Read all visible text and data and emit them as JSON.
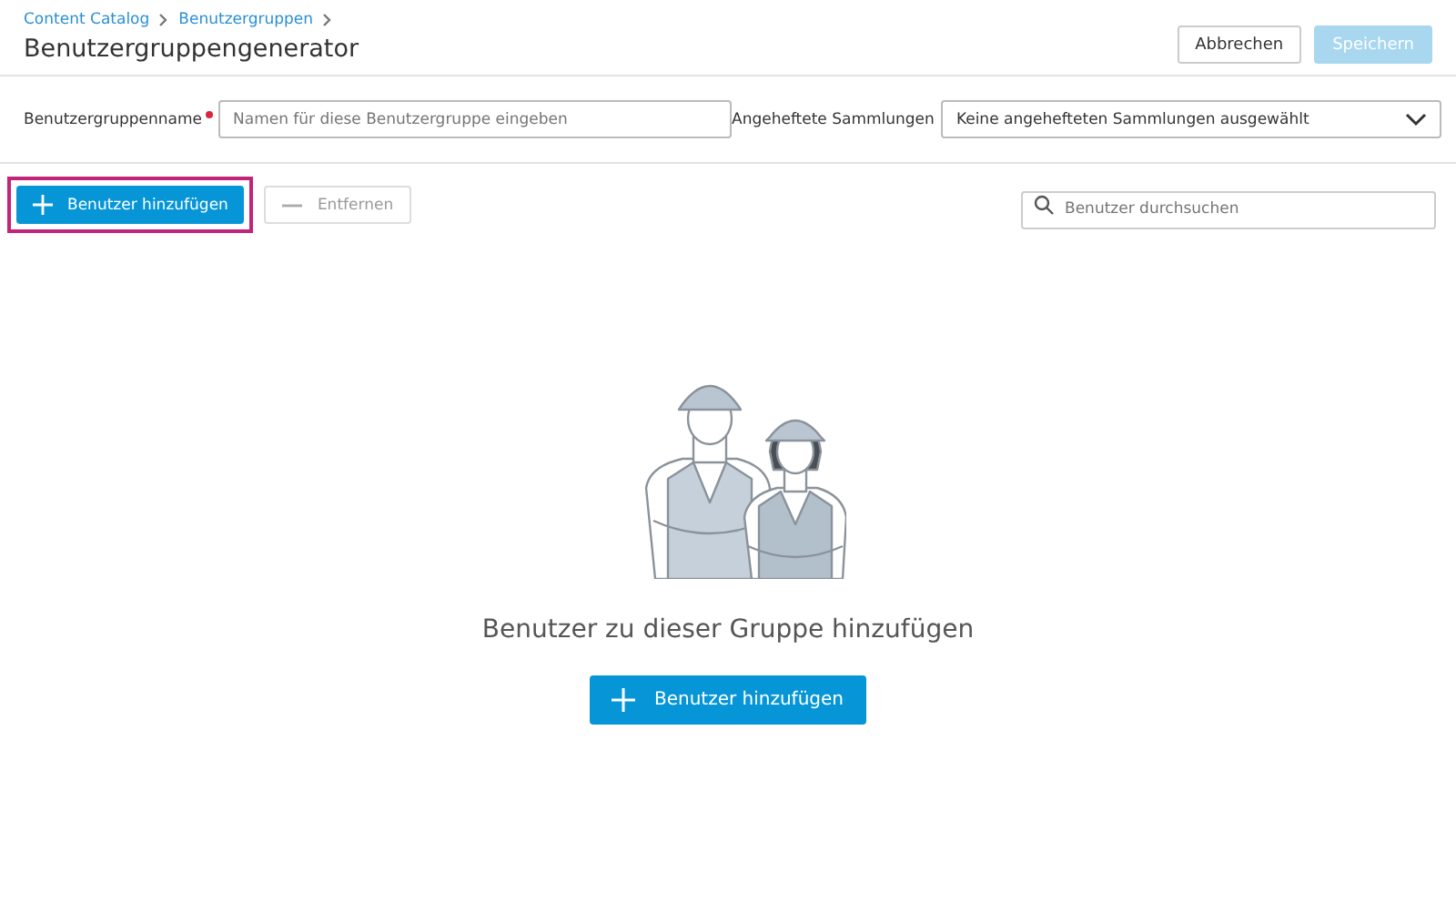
{
  "breadcrumbs": [
    {
      "label": "Content Catalog"
    },
    {
      "label": "Benutzergruppen"
    }
  ],
  "title": "Benutzergruppengenerator",
  "header_buttons": [
    {
      "label": "Abbrechen",
      "kind": "secondary",
      "disabled": false
    },
    {
      "label": "Speichern",
      "kind": "primary",
      "disabled": true
    }
  ],
  "name_field": {
    "label": "Benutzergruppenname",
    "required": true,
    "placeholder": "Namen für diese Benutzergruppe eingeben"
  },
  "collections_field": {
    "label": "Angeheftete Sammlungen",
    "value": "Keine angehefteten Sammlungen ausgewählt"
  },
  "toolbar": {
    "add_button": {
      "label": "Benutzer hinzufügen",
      "highlighted": true
    },
    "remove_button": {
      "label": "Entfernen",
      "disabled": true
    },
    "search": {
      "placeholder": "Benutzer durchsuchen"
    }
  },
  "empty_state": {
    "heading": "Benutzer zu dieser Gruppe hinzufügen",
    "button": "Benutzer hinzufügen"
  }
}
